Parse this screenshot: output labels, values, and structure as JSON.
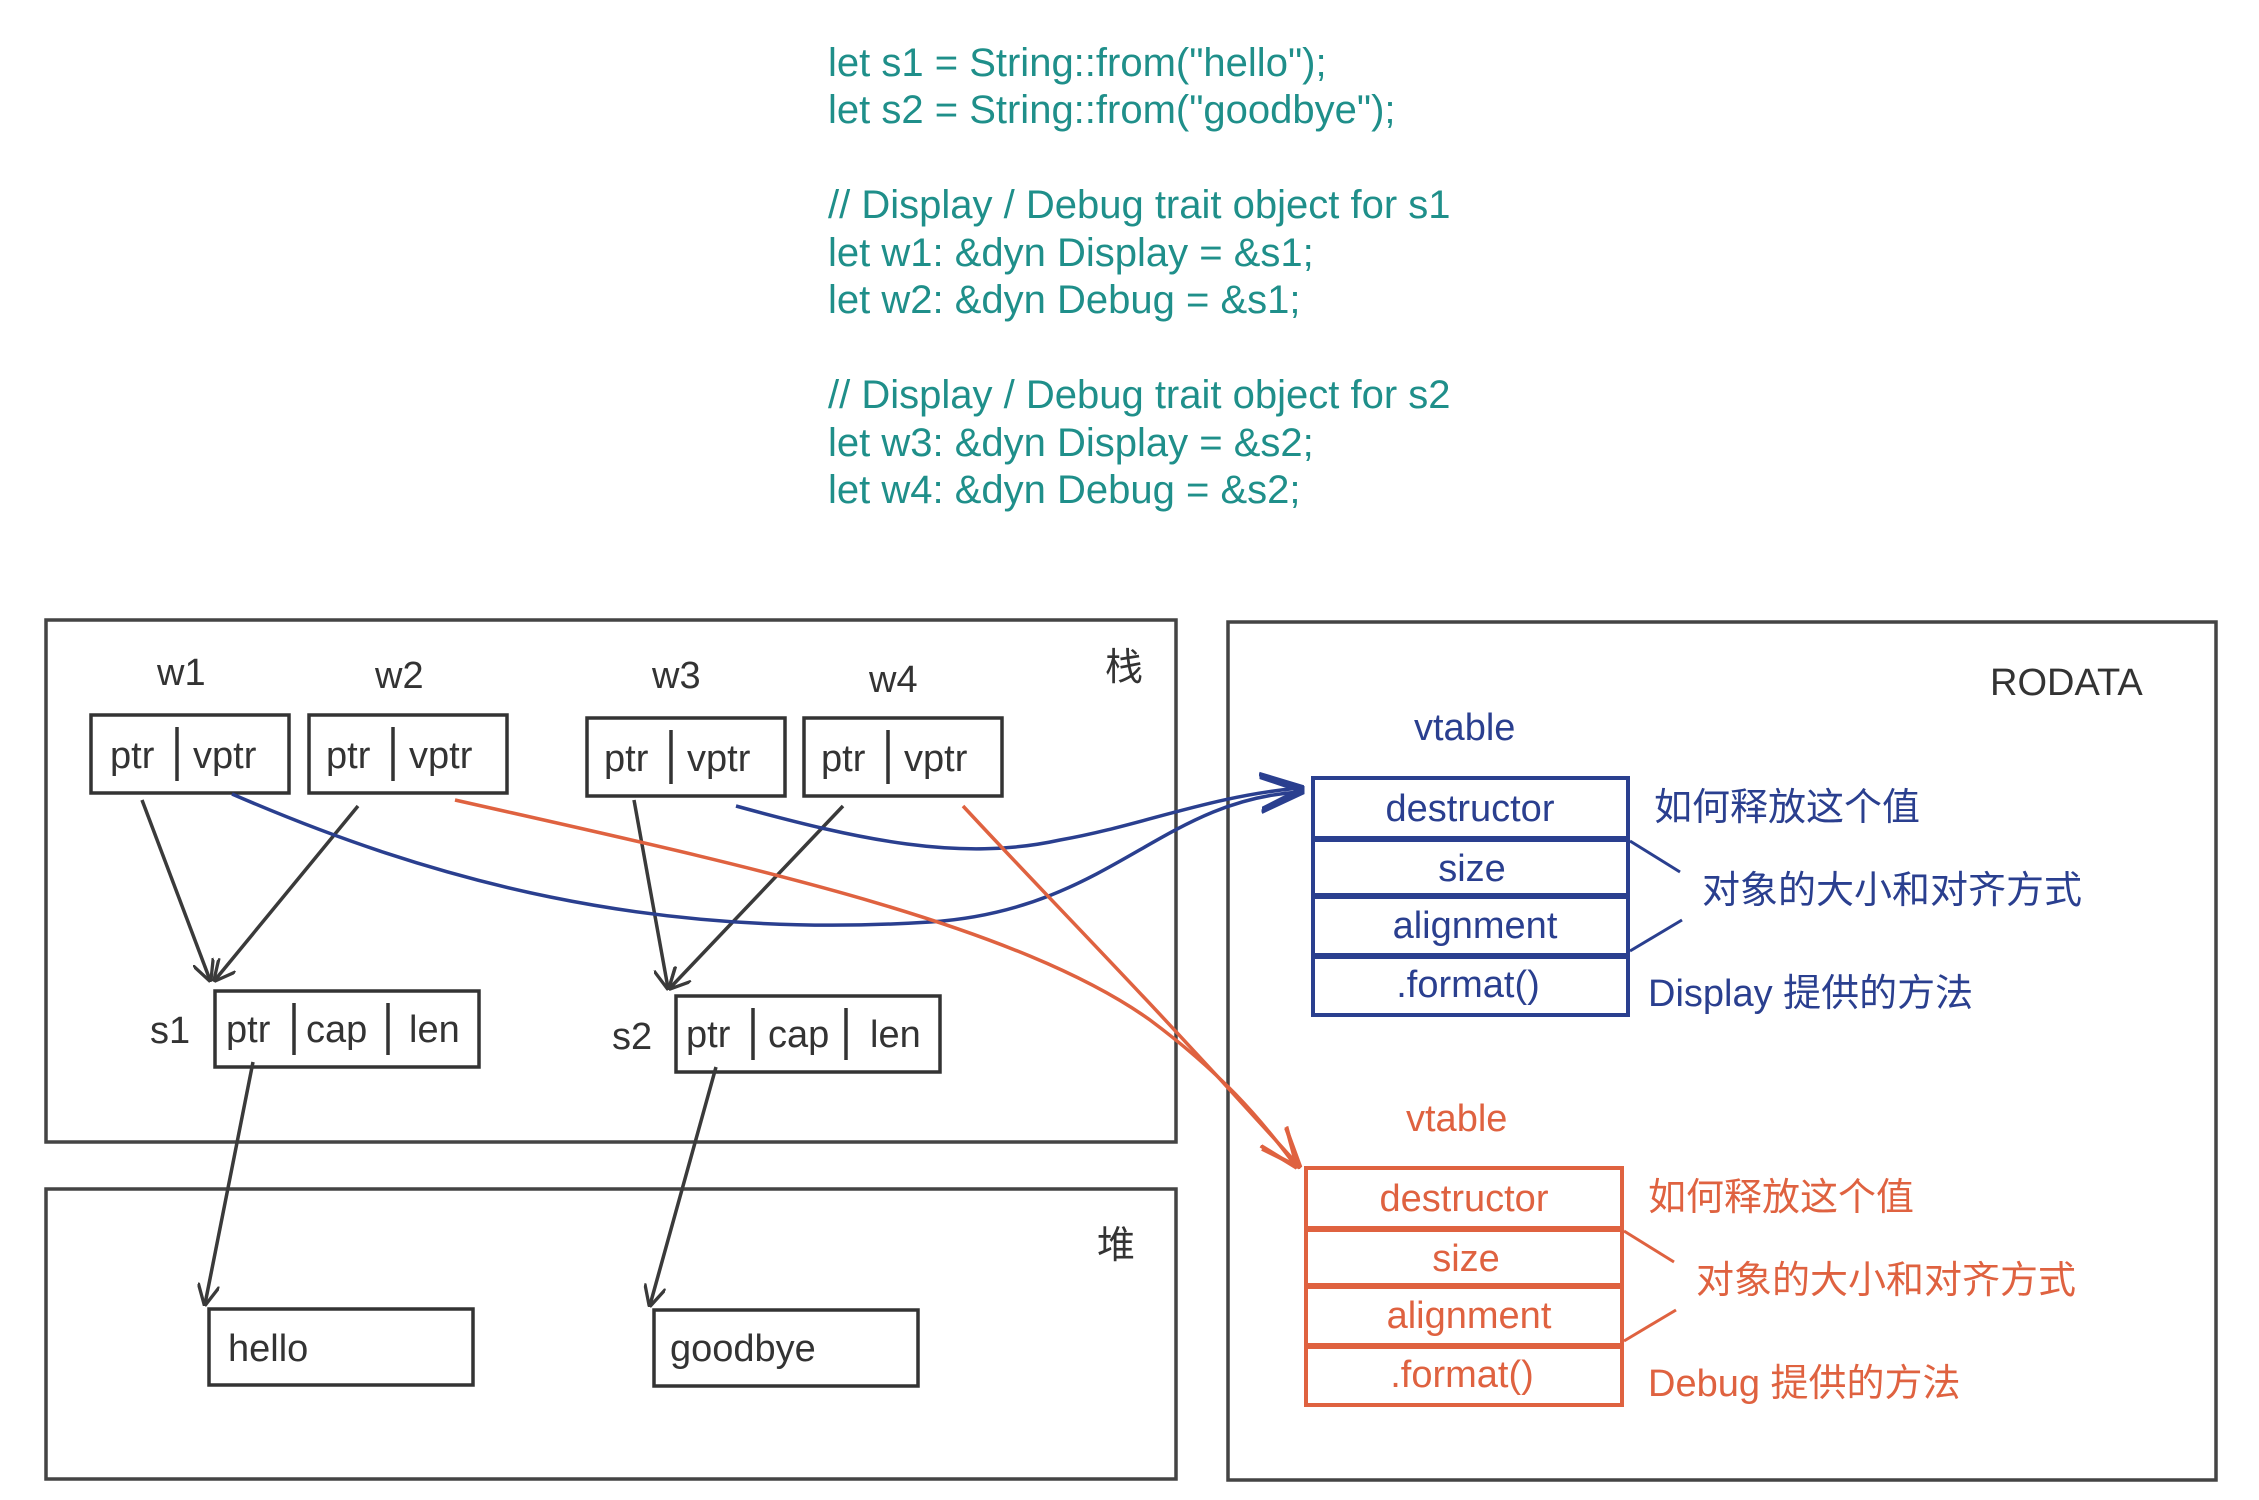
{
  "code": {
    "lines": [
      "let s1 = String::from(\"hello\");",
      "let s2 = String::from(\"goodbye\");",
      "",
      "// Display / Debug trait object for s1",
      "let w1: &dyn Display = &s1;",
      "let w2: &dyn Debug = &s1;",
      "",
      "// Display / Debug trait object for s2",
      "let w3: &dyn Display = &s2;",
      "let w4: &dyn Debug = &s2;"
    ]
  },
  "stack": {
    "label": "栈",
    "fat_pointers": [
      {
        "name": "w1",
        "ptr": "ptr",
        "vptr": "vptr"
      },
      {
        "name": "w2",
        "ptr": "ptr",
        "vptr": "vptr"
      },
      {
        "name": "w3",
        "ptr": "ptr",
        "vptr": "vptr"
      },
      {
        "name": "w4",
        "ptr": "ptr",
        "vptr": "vptr"
      }
    ],
    "strings": [
      {
        "name": "s1",
        "ptr": "ptr",
        "cap": "cap",
        "len": "len"
      },
      {
        "name": "s2",
        "ptr": "ptr",
        "cap": "cap",
        "len": "len"
      }
    ]
  },
  "heap": {
    "label": "堆",
    "values": [
      "hello",
      "goodbye"
    ]
  },
  "rodata": {
    "label": "RODATA",
    "vtables": [
      {
        "title": "vtable",
        "color": "#2a3f8f",
        "rows": [
          "destructor",
          "size",
          "alignment",
          ".format()"
        ],
        "notes": [
          "如何释放这个值",
          "对象的大小和对齐方式",
          "Display 提供的方法"
        ]
      },
      {
        "title": "vtable",
        "color": "#df6240",
        "rows": [
          "destructor",
          "size",
          "alignment",
          ".format()"
        ],
        "notes": [
          "如何释放这个值",
          "对象的大小和对齐方式",
          "Debug 提供的方法"
        ]
      }
    ]
  }
}
